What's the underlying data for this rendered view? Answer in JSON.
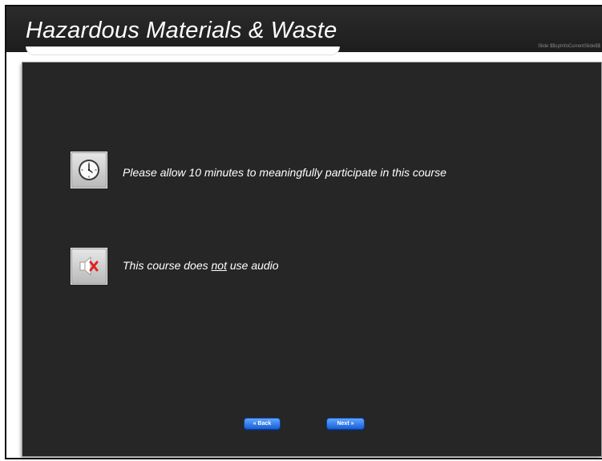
{
  "header": {
    "title": "Hazardous Materials & Waste",
    "slide_info": "Slide $$cpInfoCurrentSlide$$"
  },
  "rows": [
    {
      "icon": "clock-icon",
      "text": "Please allow 10 minutes to meaningfully participate in this course"
    },
    {
      "icon": "speaker-muted-icon",
      "text_before": "This course does ",
      "text_underlined": "not",
      "text_after": " use audio"
    }
  ],
  "nav": {
    "back_label": "« Back",
    "next_label": "Next »"
  },
  "colors": {
    "header_bg": "#222222",
    "content_bg": "#262626",
    "button_blue": "#2a72e6",
    "mute_x_red": "#e02020"
  }
}
